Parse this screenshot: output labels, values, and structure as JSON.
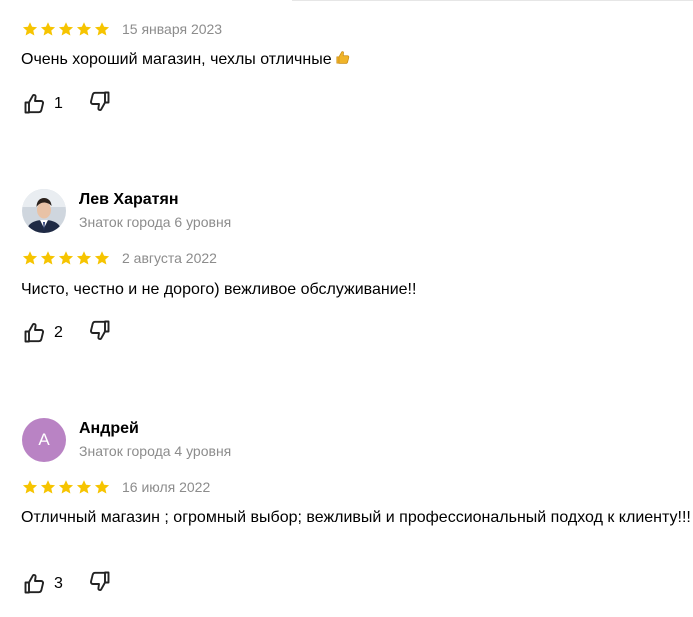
{
  "colors": {
    "star": "#f6c400",
    "muted": "#8c8c8c",
    "avatar_bg": "#b983c4"
  },
  "reviews": [
    {
      "rating": 5,
      "date": "15 января 2023",
      "text": "Очень хороший магазин, чехлы отличные",
      "emoji": "thumbs-up-emoji",
      "likes": "1"
    },
    {
      "author": {
        "name": "Лев Харатян",
        "level": "Знаток города 6 уровня",
        "avatar": "photo"
      },
      "rating": 5,
      "date": "2 августа 2022",
      "text": "Чисто, честно и не дорого) вежливое обслуживание!!",
      "likes": "2"
    },
    {
      "author": {
        "name": "Андрей",
        "level": "Знаток города 4 уровня",
        "avatar_letter": "А"
      },
      "rating": 5,
      "date": "16 июля 2022",
      "text": "Отличный магазин ; огромный выбор; вежливый и профессиональный подход к клиенту!!!",
      "likes": "3"
    }
  ]
}
